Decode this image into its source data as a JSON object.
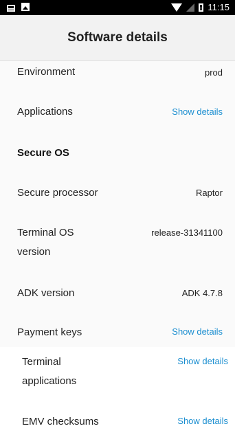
{
  "status_bar": {
    "time": "11:15",
    "icons": [
      "panel-icon",
      "image-icon",
      "wifi-icon",
      "signal-icon",
      "battery-icon"
    ]
  },
  "header": {
    "title": "Software details"
  },
  "rows": [
    {
      "label": "Environment",
      "value": "prod"
    },
    {
      "label": "Applications",
      "value": "Show details"
    },
    {
      "label": "Secure OS"
    },
    {
      "label": "Secure processor",
      "value": "Raptor"
    },
    {
      "label_line1": "Terminal OS",
      "label_line2": "version",
      "value": "release-31341100"
    },
    {
      "label": "ADK version",
      "value": "ADK 4.7.8"
    },
    {
      "label": "Payment keys",
      "value": "Show details"
    },
    {
      "label_line1": "Terminal",
      "label_line2": "applications",
      "value": "Show details"
    },
    {
      "label": "EMV checksums",
      "value": "Show details"
    }
  ],
  "colors": {
    "link": "#1b8ed0",
    "status_bar": "#000000",
    "app_bar": "#f2f2f2"
  }
}
